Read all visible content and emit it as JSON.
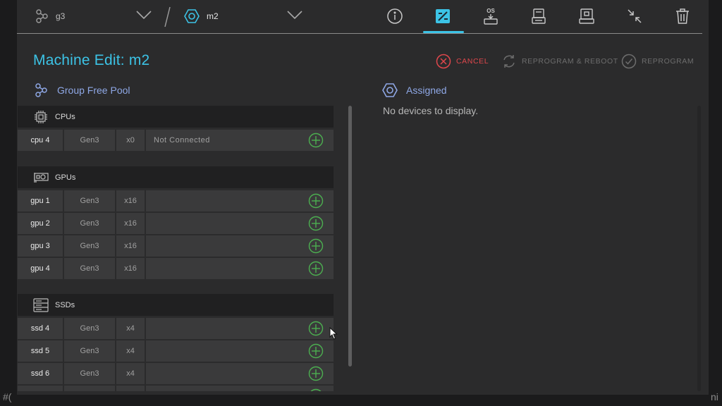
{
  "topbar": {
    "group_name": "g3",
    "machine_name": "m2",
    "tools": [
      {
        "name": "info-icon"
      },
      {
        "name": "edit-icon",
        "active": true
      },
      {
        "name": "os-install-icon",
        "label": "OS"
      },
      {
        "name": "firmware-icon"
      },
      {
        "name": "machine-config-icon"
      },
      {
        "name": "collapse-icon"
      },
      {
        "name": "trash-icon"
      }
    ]
  },
  "page": {
    "title": "Machine Edit: m2",
    "actions": {
      "cancel": "CANCEL",
      "reprogram_reboot": "REPROGRAM & REBOOT",
      "reprogram": "REPROGRAM"
    }
  },
  "pool": {
    "title": "Group Free Pool",
    "categories": [
      {
        "label": "CPUs",
        "devices": [
          {
            "name": "cpu 4",
            "gen": "Gen3",
            "width": "x0",
            "status": "Not Connected"
          }
        ]
      },
      {
        "label": "GPUs",
        "devices": [
          {
            "name": "gpu 1",
            "gen": "Gen3",
            "width": "x16",
            "status": ""
          },
          {
            "name": "gpu 2",
            "gen": "Gen3",
            "width": "x16",
            "status": ""
          },
          {
            "name": "gpu 3",
            "gen": "Gen3",
            "width": "x16",
            "status": ""
          },
          {
            "name": "gpu 4",
            "gen": "Gen3",
            "width": "x16",
            "status": ""
          }
        ]
      },
      {
        "label": "SSDs",
        "devices": [
          {
            "name": "ssd 4",
            "gen": "Gen3",
            "width": "x4",
            "status": ""
          },
          {
            "name": "ssd 5",
            "gen": "Gen3",
            "width": "x4",
            "status": ""
          },
          {
            "name": "ssd 6",
            "gen": "Gen3",
            "width": "x4",
            "status": ""
          }
        ]
      }
    ]
  },
  "assigned": {
    "title": "Assigned",
    "empty_message": "No devices to display."
  },
  "edge_text": {
    "left": "#(",
    "right": "ni"
  },
  "colors": {
    "accent": "#3cc3e6",
    "cancel": "#e0474c",
    "add": "#4caf50",
    "section": "#8fa8e6"
  }
}
